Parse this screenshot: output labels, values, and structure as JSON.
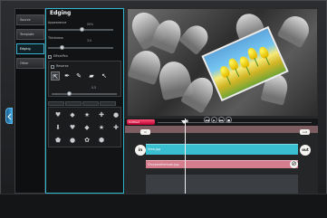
{
  "app": {
    "colors": {
      "accent": "#32b6cf",
      "timeline_red": "#d6224d",
      "track_teal": "#3ac0d0",
      "track_pink": "#d57d8d",
      "panel": "#111314"
    }
  },
  "nav": {
    "items": [
      {
        "label": "Source",
        "icon": "none"
      },
      {
        "label": "Template",
        "icon": "none"
      },
      {
        "label": "Edging",
        "icon": "none"
      },
      {
        "label": "Other",
        "icon": "none"
      }
    ]
  },
  "panel": {
    "title": "Edging",
    "appearance_label": "Appearance",
    "appearance_value": "50%",
    "appearance_fraction": 0.5,
    "thickness_label": "Thickness",
    "thickness_value": "3.0",
    "thickness_fraction": 0.2,
    "effectpen_label": "EffectPen",
    "reverse_label": "Reverse",
    "tool_value": "0.5",
    "tab_labels": [
      "",
      "",
      "",
      ""
    ],
    "tools": [
      "arrow-up-icon",
      "pen-icon",
      "brush-icon",
      "eraser-icon",
      "arrow-icon"
    ],
    "shapes": [
      "heart-icon",
      "diamond-icon",
      "star-icon",
      "cross-icon",
      "circle-icon",
      "arrow-down-icon",
      "heart-icon",
      "diamond-icon",
      "star-icon",
      "cross-icon",
      "octagon-icon",
      "circle-icon",
      "flower-icon",
      "hexagon-icon"
    ]
  },
  "timeline": {
    "label": "Untitled",
    "in_label": "in",
    "out_label": "out",
    "in_chip": "in",
    "out_chip": "out",
    "tracks": [
      {
        "name": "View.jpg",
        "color": "#3ac0d0"
      },
      {
        "name": "Chrysanthemum.jpg",
        "color": "#d57d8d"
      }
    ],
    "playback": {
      "play_label": "▶",
      "back_label": "◀◀",
      "forward_label": "▶▶",
      "stop_label": "■"
    }
  }
}
